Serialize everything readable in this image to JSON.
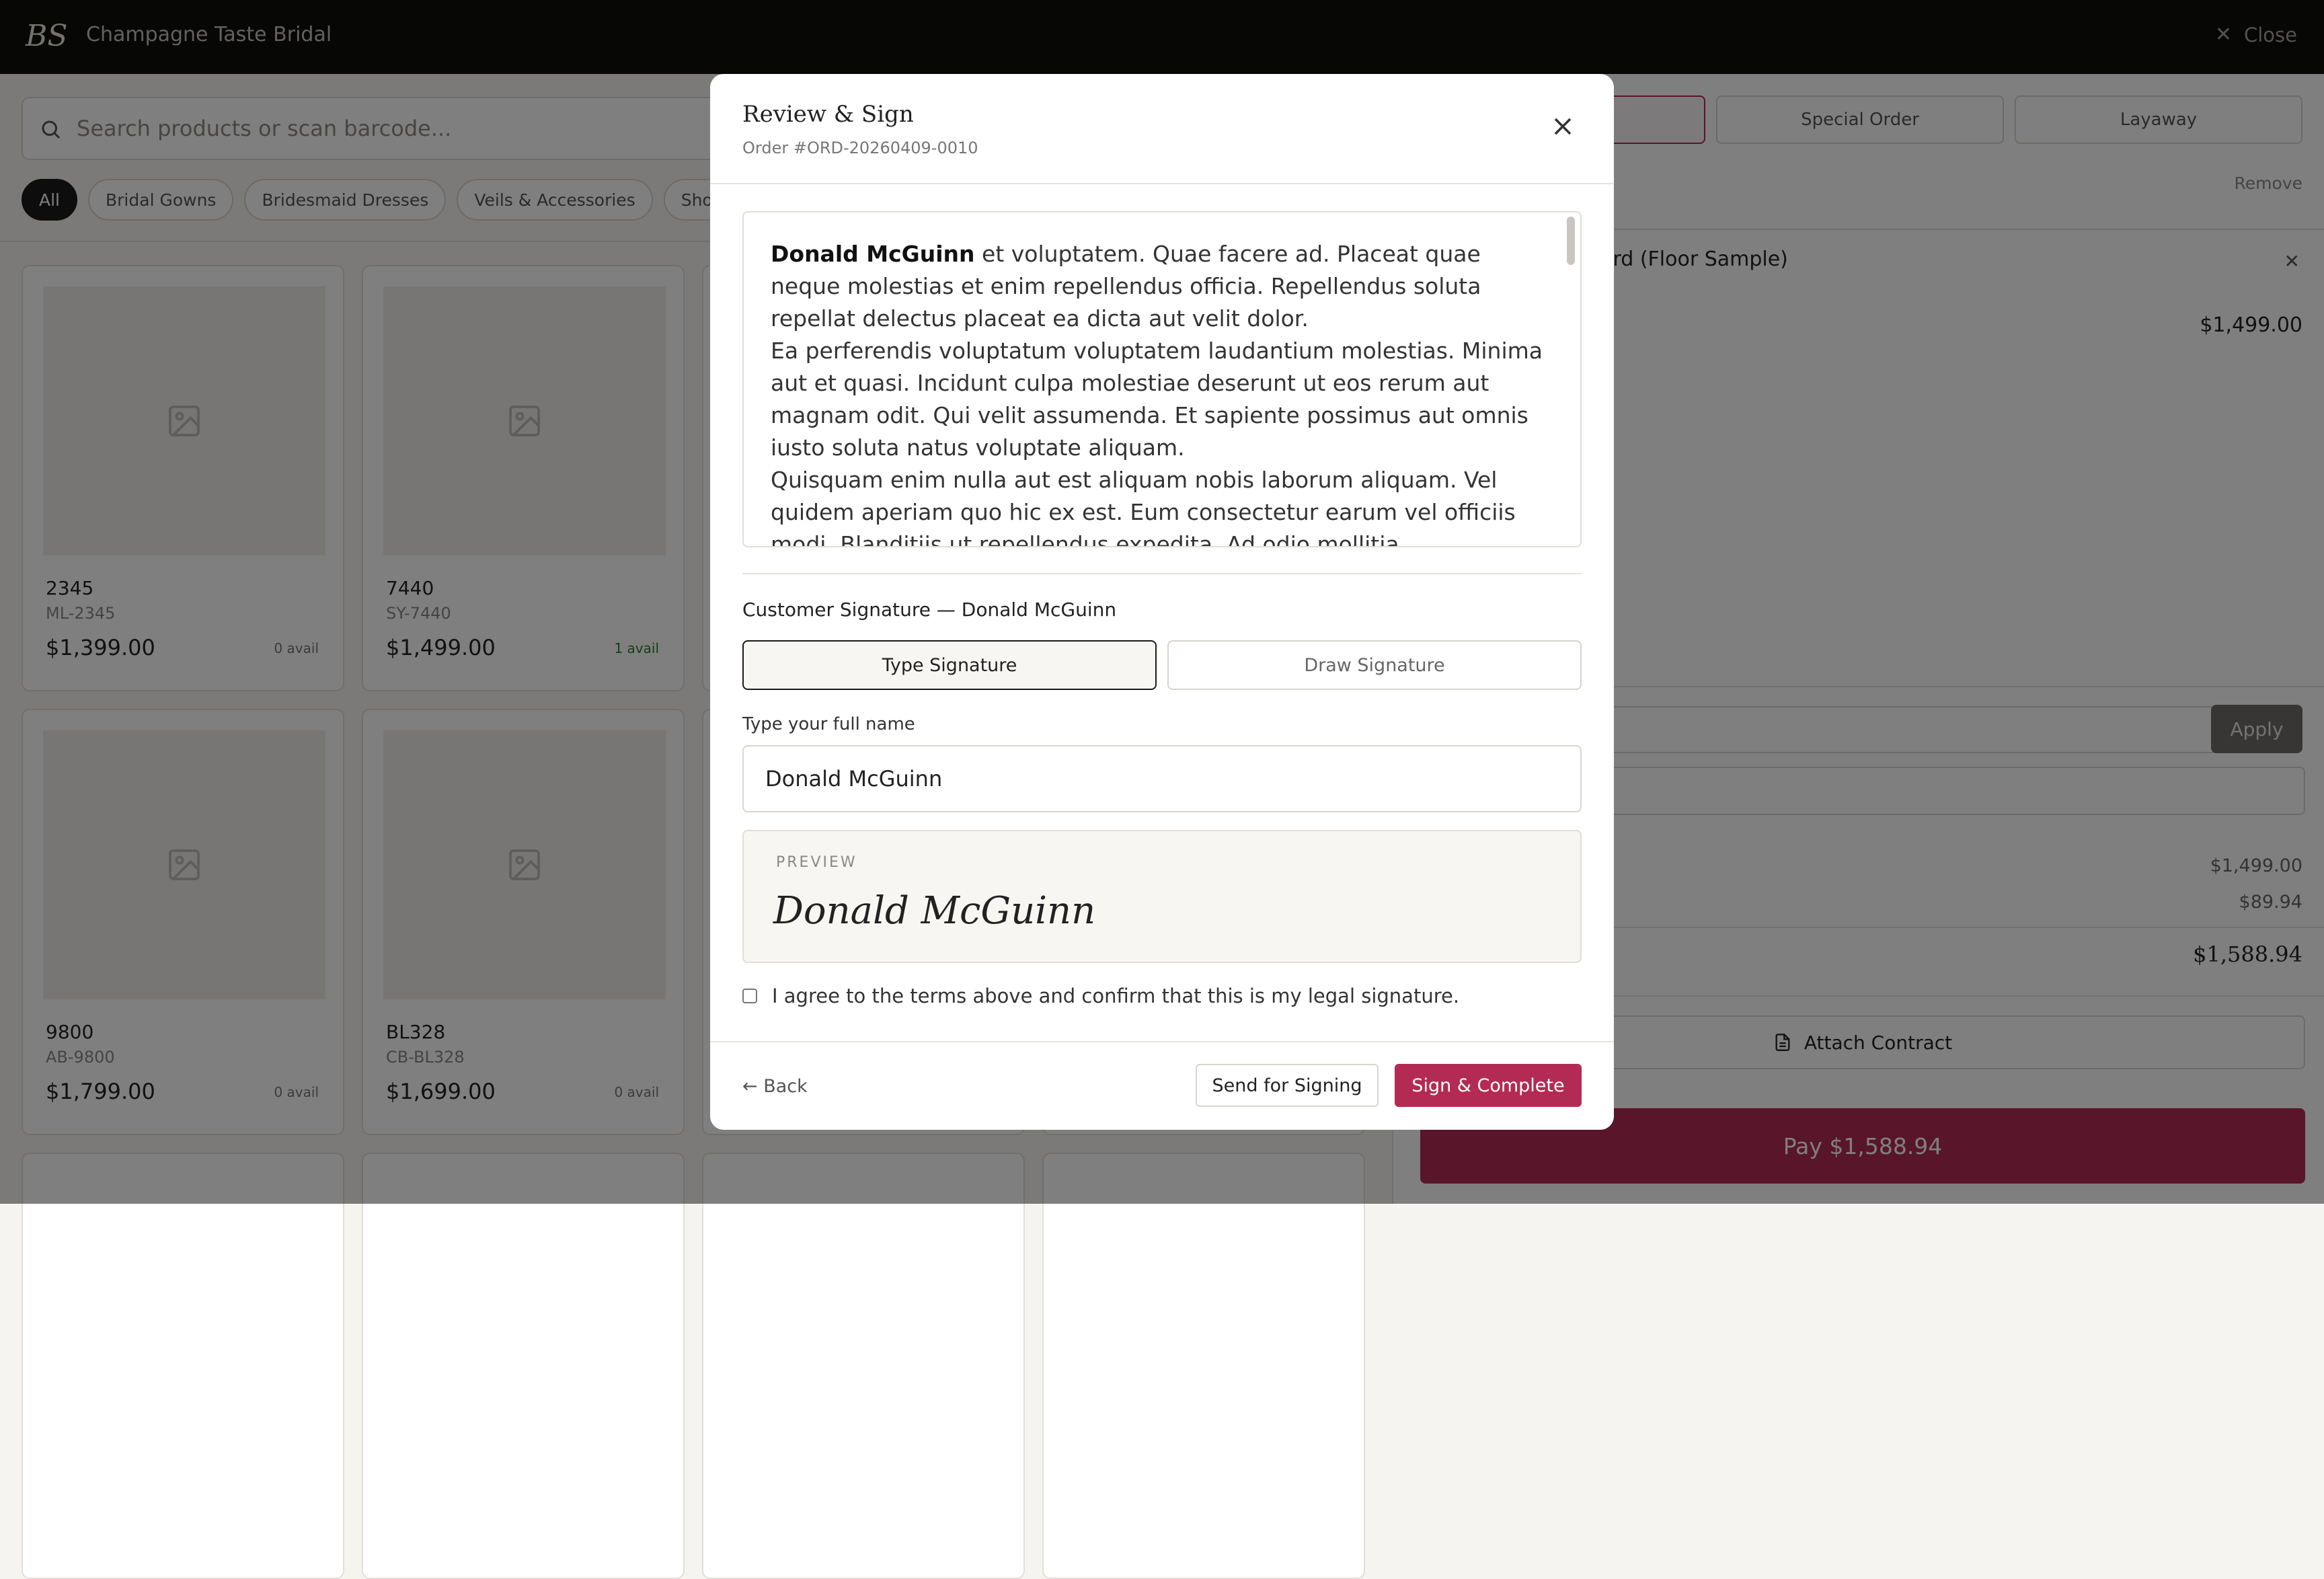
{
  "topbar": {
    "logo_text": "BS",
    "brand": "Champagne Taste Bridal",
    "close_label": "Close"
  },
  "catalog": {
    "search_placeholder": "Search products or scan barcode...",
    "categories": [
      "All",
      "Bridal Gowns",
      "Bridesmaid Dresses",
      "Veils & Accessories",
      "Shoes"
    ],
    "active_category": "All",
    "products": [
      {
        "name": "2345",
        "sku": "ML-2345",
        "price": "$1,399.00",
        "avail": "0 avail"
      },
      {
        "name": "7440",
        "sku": "SY-7440",
        "price": "$1,499.00",
        "avail": "1 avail"
      },
      {
        "name": "9800",
        "sku": "AB-9800",
        "price": "$1,799.00",
        "avail": "0 avail"
      },
      {
        "name": "BL328",
        "sku": "CB-BL328",
        "price": "$1,699.00",
        "avail": "0 avail"
      }
    ]
  },
  "cart": {
    "order_types": [
      "Special Order",
      "Layaway"
    ],
    "remove_label": "Remove",
    "item_title": "ndard (Floor Sample)",
    "item_price": "$1,499.00",
    "apply_label": "Apply",
    "subtotal": "$1,499.00",
    "tax": "$89.94",
    "total": "$1,588.94",
    "attach_label": "Attach Contract",
    "pay_label": "Pay $1,588.94"
  },
  "modal": {
    "title": "Review & Sign",
    "subtitle": "Order #ORD-20260409-0010",
    "terms": {
      "name": "Donald McGuinn",
      "p1": " et voluptatem. Quae facere ad. Placeat quae neque molestias et enim repellendus officia. Repellendus soluta repellat delectus placeat ea dicta aut velit dolor.",
      "p2": "Ea perferendis voluptatum voluptatem laudantium molestias. Minima aut et quasi. Incidunt culpa molestiae deserunt ut eos rerum aut magnam odit. Qui velit assumenda. Et sapiente possimus aut omnis iusto soluta natus voluptate aliquam.",
      "p3": "Quisquam enim nulla aut est aliquam nobis laborum aliquam. Vel quidem aperiam quo hic ex est. Eum consectetur earum vel officiis modi. Blanditiis ut repellendus expedita. Ad odio mollitia."
    },
    "signature_label": "Customer Signature — Donald McGuinn",
    "tab_type": "Type Signature",
    "tab_draw": "Draw Signature",
    "fullname_label": "Type your full name",
    "fullname_value": "Donald McGuinn",
    "preview_label": "PREVIEW",
    "preview_signature": "Donald McGuinn",
    "agree_text": "I agree to the terms above and confirm that this is my legal signature.",
    "back_label": "← Back",
    "send_label": "Send for Signing",
    "sign_label": "Sign & Complete"
  },
  "colors": {
    "accent": "#b32b55",
    "topbar": "#0f0e0d"
  }
}
